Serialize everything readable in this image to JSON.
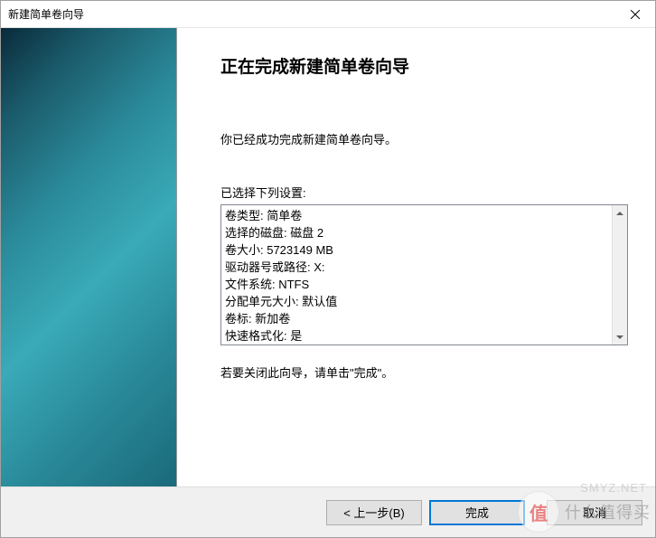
{
  "window": {
    "title": "新建简单卷向导"
  },
  "content": {
    "heading": "正在完成新建简单卷向导",
    "intro": "你已经成功完成新建简单卷向导。",
    "settings_label": "已选择下列设置:",
    "closing_text": "若要关闭此向导，请单击\"完成\"。"
  },
  "settings": [
    "卷类型: 简单卷",
    "选择的磁盘: 磁盘 2",
    "卷大小: 5723149 MB",
    "驱动器号或路径: X:",
    "文件系统: NTFS",
    "分配单元大小: 默认值",
    "卷标: 新加卷",
    "快速格式化: 是"
  ],
  "footer": {
    "back": "< 上一步(B)",
    "finish": "完成",
    "cancel": "取消"
  },
  "watermark": {
    "badge": "值",
    "text": "什么值得买",
    "net": "SMYZ.NET"
  }
}
